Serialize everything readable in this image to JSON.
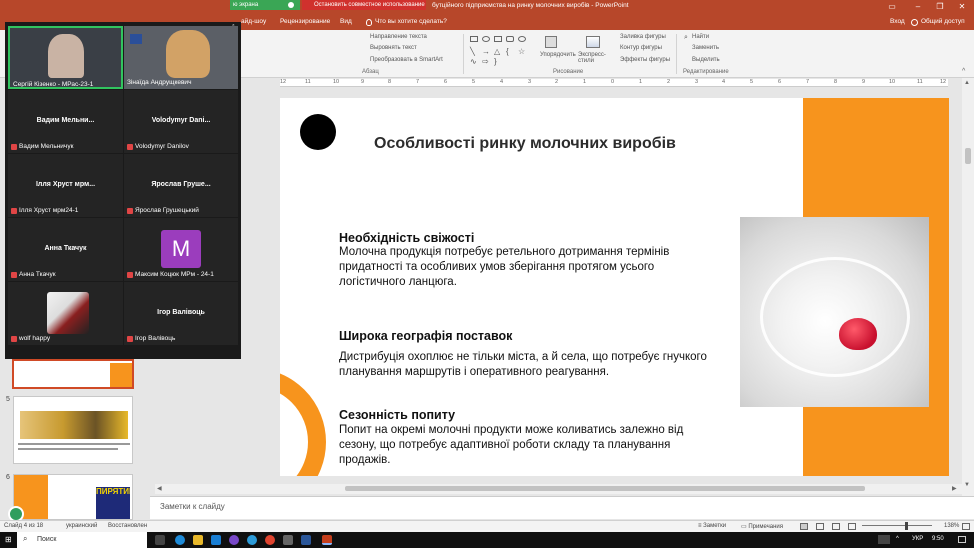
{
  "window": {
    "share_label": "ю экрана",
    "stop_share_label": "Остановить совместное использование",
    "doc_title": "бутційного підприємства на ринку молочних виробів - PowerPoint"
  },
  "ribbon_tabs": {
    "tabs": [
      "айд-шоу",
      "Рецензирование",
      "Вид"
    ],
    "tell_me": "Что вы хотите сделать?",
    "sign_in": "Вход",
    "share": "Общий доступ"
  },
  "ribbon": {
    "paragraph": {
      "text_direction": "Направление текста",
      "align_text": "Выровнять текст",
      "smartart": "Преобразовать в SmartArt",
      "group_label": "Абзац"
    },
    "drawing": {
      "arrange": "Упорядочить",
      "quick_styles": "Экспресс-стили",
      "shape_fill": "Заливка фигуры",
      "shape_outline": "Контур фигуры",
      "shape_effects": "Эффекты фигуры",
      "group_label": "Рисование"
    },
    "editing": {
      "find": "Найти",
      "replace": "Заменить",
      "select": "Выделить",
      "group_label": "Редактирование"
    }
  },
  "ruler": {
    "numbers": [
      "12",
      "11",
      "10",
      "9",
      "8",
      "7",
      "6",
      "5",
      "4",
      "3",
      "2",
      "1",
      "0",
      "1",
      "2",
      "3",
      "4",
      "5",
      "6",
      "7",
      "8",
      "9",
      "10",
      "11",
      "12"
    ]
  },
  "zoom": {
    "participants": [
      {
        "label": "Сергій Кізенко - МРас-23-1",
        "type": "video"
      },
      {
        "label": "Зінаїда Андрущкевич",
        "type": "video"
      },
      {
        "name": "Вадим Мельни...",
        "label": "Вадим Мельничук"
      },
      {
        "name": "Volodymyr Dani...",
        "label": "Volodymyr Danilov"
      },
      {
        "name": "Ілля Хруст мрм...",
        "label": "Ілля Хруст мрм24-1"
      },
      {
        "name": "Ярослав Груше...",
        "label": "Ярослав Грушецький"
      },
      {
        "name": "Анна Ткачук",
        "label": "Анна Ткачук"
      },
      {
        "avatar": "M",
        "label": "Максим Коцюк МРм - 24-1"
      },
      {
        "label": "wolf happy",
        "type": "image"
      },
      {
        "name": "Ігор Валівоць",
        "label": "Ігор Валівоць"
      }
    ],
    "avatar_color": "#9b3dbd"
  },
  "thumbnails": {
    "numbers": [
      "5",
      "6"
    ],
    "slide6_text": "ПИРЯТИН"
  },
  "slide": {
    "title": "Особливості ринку молочних виробів",
    "sections": [
      {
        "heading": "Необхідність свіжості",
        "text": "Молочна продукція потребує ретельного дотримання термінів придатності та особливих умов зберігання протягом усього логістичного ланцюга."
      },
      {
        "heading": "Широка географія поставок",
        "text": "Дистрибуція охоплює не тільки міста, а й села, що потребує гнучкого планування маршрутів і оперативного реагування."
      },
      {
        "heading": "Сезонність попиту",
        "text": "Попит на окремі молочні продукти може коливатись залежно від сезону, що потребує адаптивної роботи складу та планування продажів."
      }
    ],
    "accent_color": "#f7941d"
  },
  "notes": {
    "placeholder": "Заметки к слайду"
  },
  "status": {
    "slide_counter": "Слайд 4 из 18",
    "language": "украинский",
    "recovered": "Восстановлен",
    "notes_btn": "Заметки",
    "comments_btn": "Примечания",
    "zoom": "138%"
  },
  "taskbar": {
    "search": "Поиск",
    "lang": "УКР",
    "time": "9:50"
  }
}
